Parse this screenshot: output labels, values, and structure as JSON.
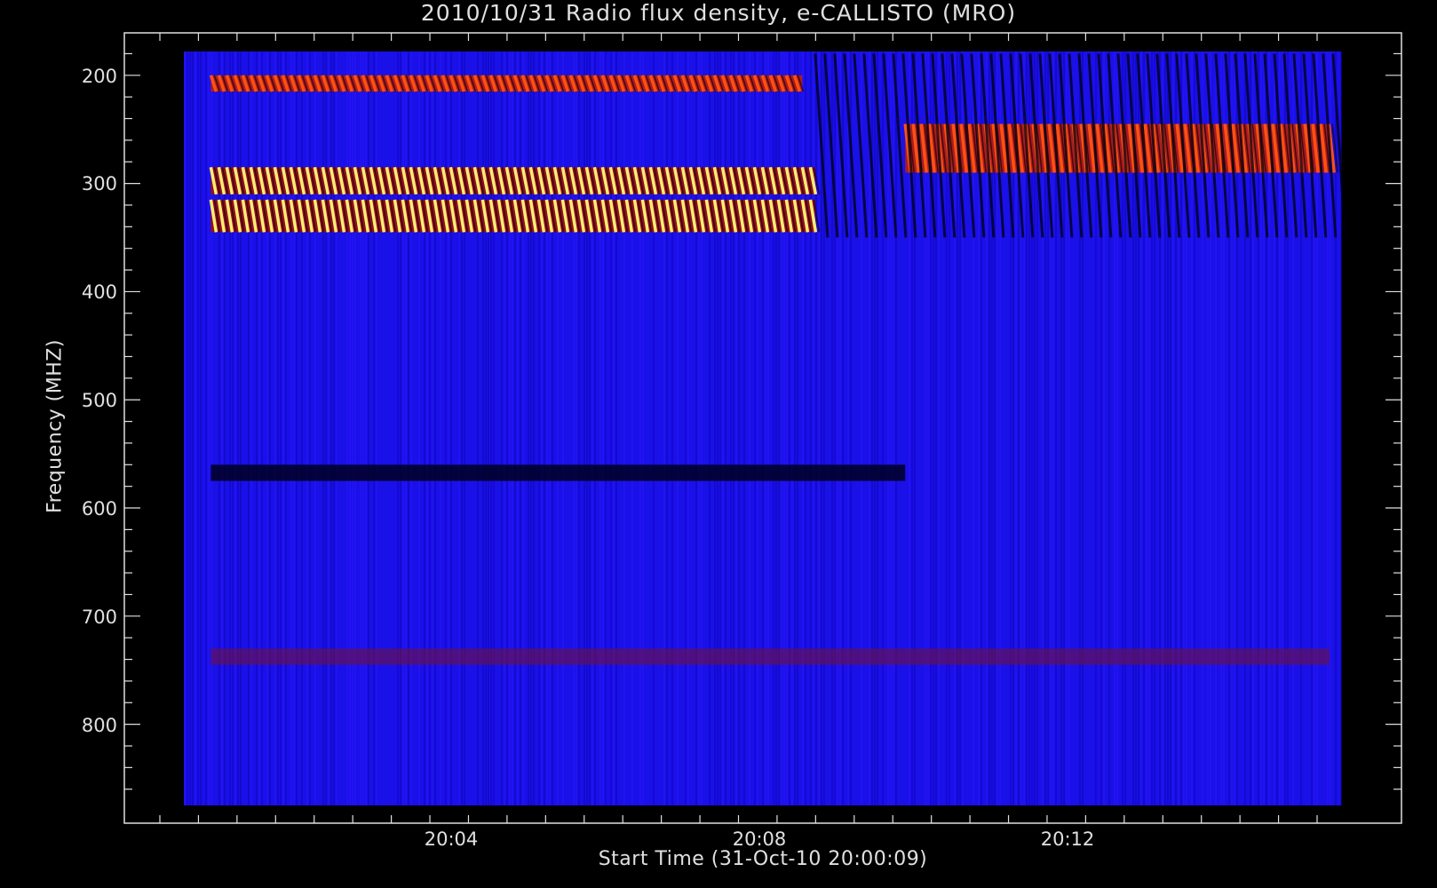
{
  "chart_data": {
    "type": "heatmap",
    "title": "2010/10/31  Radio flux density, e-CALLISTO (MRO)",
    "xlabel": "Start Time (31-Oct-10 20:00:09)",
    "ylabel": "Frequency (MHZ)",
    "x_ticks": [
      "20:04",
      "20:08",
      "20:12"
    ],
    "y_ticks": [
      "200",
      "300",
      "400",
      "500",
      "600",
      "700",
      "800"
    ],
    "y_range_mhz": [
      178,
      875
    ],
    "x_range": [
      "20:00:09",
      "20:15:09"
    ],
    "colormap": [
      "#000000",
      "#0000ff",
      "#800000",
      "#ff2000",
      "#ff8000",
      "#ffff80"
    ],
    "features": [
      {
        "band_mhz": [
          200,
          215
        ],
        "time": [
          "20:00:30",
          "20:08:10"
        ],
        "intensity": "high"
      },
      {
        "band_mhz": [
          285,
          310
        ],
        "time": [
          "20:00:30",
          "20:08:20"
        ],
        "intensity": "very high"
      },
      {
        "band_mhz": [
          315,
          345
        ],
        "time": [
          "20:00:30",
          "20:08:20"
        ],
        "intensity": "very high"
      },
      {
        "band_mhz": [
          245,
          290
        ],
        "time": [
          "20:09:30",
          "20:15:00"
        ],
        "intensity": "high"
      },
      {
        "band_mhz": [
          560,
          575
        ],
        "time": [
          "20:00:30",
          "20:09:30"
        ],
        "intensity": "absorption"
      },
      {
        "band_mhz": [
          730,
          745
        ],
        "time": [
          "20:00:30",
          "20:15:00"
        ],
        "intensity": "low"
      }
    ]
  }
}
